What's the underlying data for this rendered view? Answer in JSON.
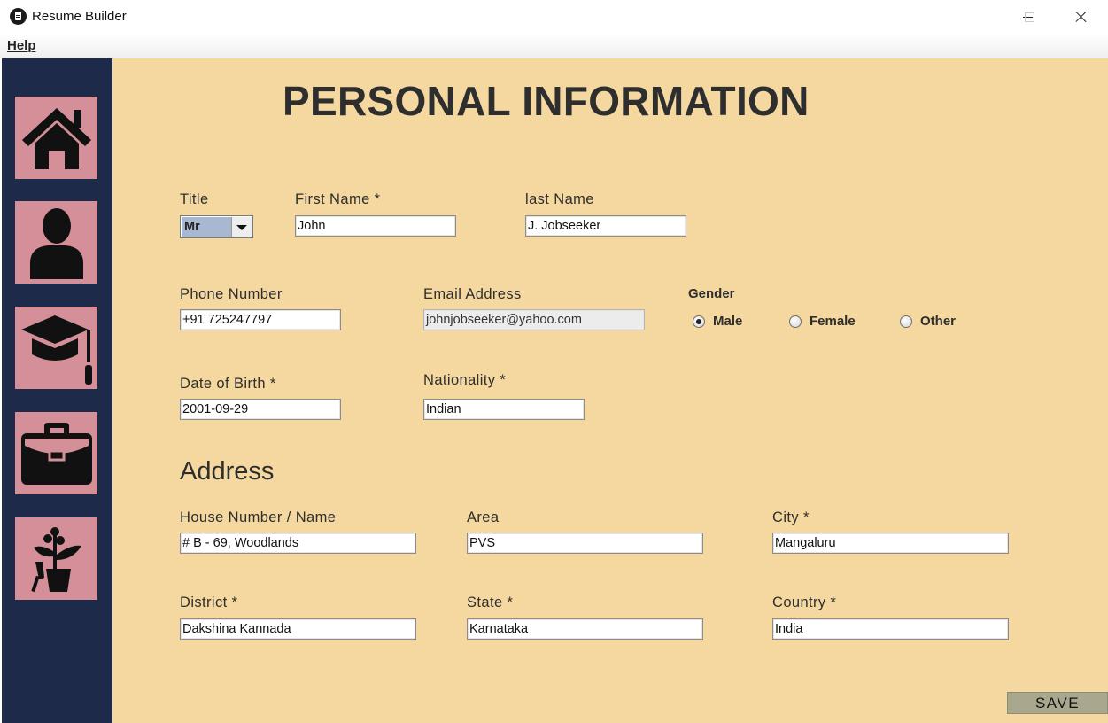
{
  "window": {
    "title": "Resume Builder",
    "controls": [
      "minimize",
      "maximize",
      "close"
    ]
  },
  "menubar": {
    "help": "Help"
  },
  "sidebar": {
    "background": "#1d2a4a",
    "tile_color": "#d48f98",
    "items": [
      {
        "icon": "home-icon"
      },
      {
        "icon": "user-icon"
      },
      {
        "icon": "graduation-cap-icon"
      },
      {
        "icon": "briefcase-icon"
      },
      {
        "icon": "plant-shovel-icon"
      }
    ]
  },
  "main": {
    "background": "#f5d8a0",
    "heading": "PERSONAL INFORMATION",
    "title": {
      "label": "Title",
      "value": "Mr"
    },
    "first_name": {
      "label": "First Name *",
      "value": "John"
    },
    "last_name": {
      "label": "last Name",
      "value": "J. Jobseeker"
    },
    "phone": {
      "label": "Phone Number",
      "value": "+91 725247797"
    },
    "email": {
      "label": "Email Address",
      "value": "johnjobseeker@yahoo.com"
    },
    "gender": {
      "label": "Gender",
      "options": [
        "Male",
        "Female",
        "Other"
      ],
      "selected": "Male"
    },
    "dob": {
      "label": "Date of Birth *",
      "value": "2001-09-29"
    },
    "nationality": {
      "label": "Nationality *",
      "value": "Indian"
    },
    "address_heading": "Address",
    "house": {
      "label": "House Number / Name",
      "value": "# B - 69, Woodlands"
    },
    "area": {
      "label": "Area",
      "value": "PVS"
    },
    "city": {
      "label": "City *",
      "value": "Mangaluru"
    },
    "district": {
      "label": "District *",
      "value": "Dakshina Kannada"
    },
    "state": {
      "label": "State *",
      "value": "Karnataka"
    },
    "country": {
      "label": "Country *",
      "value": "India"
    },
    "save": "SAVE"
  }
}
